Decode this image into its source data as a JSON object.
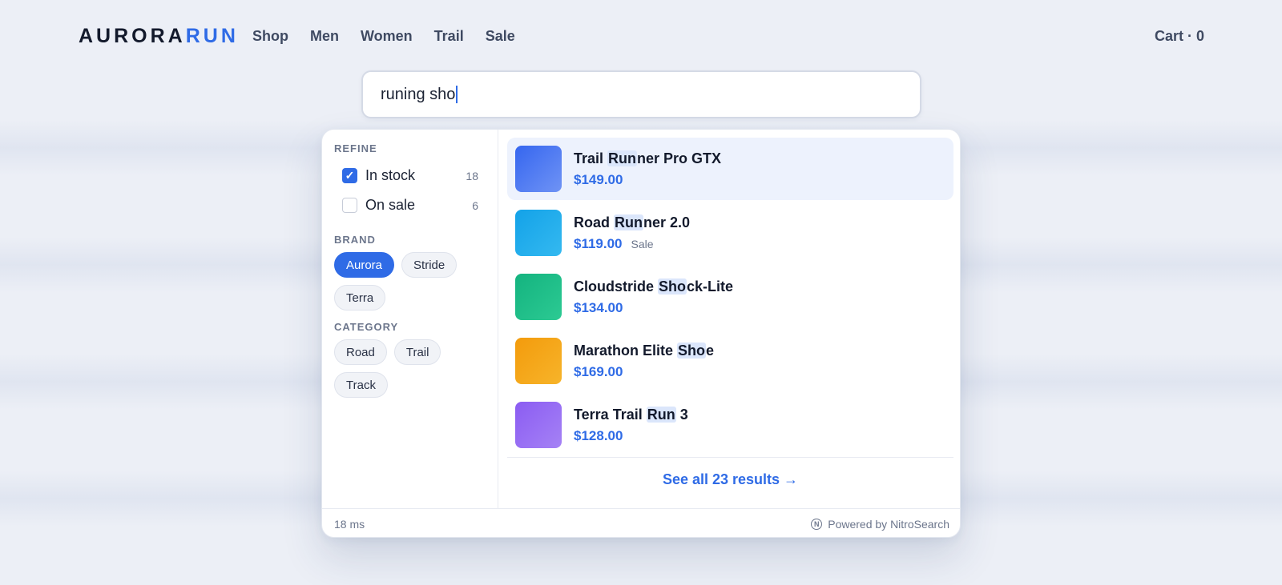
{
  "brand": {
    "part1": "AURORA",
    "part2": "RUN"
  },
  "nav": [
    "Shop",
    "Men",
    "Women",
    "Trail",
    "Sale"
  ],
  "cart": "Cart · 0",
  "search": {
    "value": "runing sho"
  },
  "filters": {
    "refine": {
      "title": "REFINE",
      "options": [
        {
          "label": "In stock",
          "count": "18",
          "checked": true
        },
        {
          "label": "On sale",
          "count": "6",
          "checked": false
        }
      ]
    },
    "brand": {
      "title": "BRAND",
      "chips": [
        "Aurora",
        "Stride",
        "Terra"
      ],
      "active": "Aurora"
    },
    "category": {
      "title": "CATEGORY",
      "chips": [
        "Road",
        "Trail",
        "Track"
      ]
    }
  },
  "results": [
    {
      "pre": "Trail ",
      "match": "Run",
      "post": "ner Pro GTX",
      "price": "$149.00",
      "badge": "",
      "color": "#3b6df0",
      "active": true
    },
    {
      "pre": "Road ",
      "match": "Run",
      "post": "ner 2.0",
      "price": "$119.00",
      "badge": "Sale",
      "color": "#1aa8ea",
      "active": false
    },
    {
      "pre": "Cloudstride ",
      "match": "Sho",
      "post": "ck-Lite",
      "price": "$134.00",
      "badge": "",
      "color": "#19bb86",
      "active": false
    },
    {
      "pre": "Marathon Elite ",
      "match": "Sho",
      "post": "e",
      "price": "$169.00",
      "badge": "",
      "color": "#f4a010",
      "active": false
    },
    {
      "pre": "Terra Trail ",
      "match": "Run",
      "post": " 3",
      "price": "$128.00",
      "badge": "",
      "color": "#9166f3",
      "active": false
    }
  ],
  "see_all": "See all 23 results →",
  "footer": {
    "latency": "18 ms",
    "powered": "Powered by NitroSearch",
    "icon_letter": "N"
  },
  "icons": {
    "checkmark": "check-icon",
    "provider": "nitrosearch-logo-icon"
  }
}
